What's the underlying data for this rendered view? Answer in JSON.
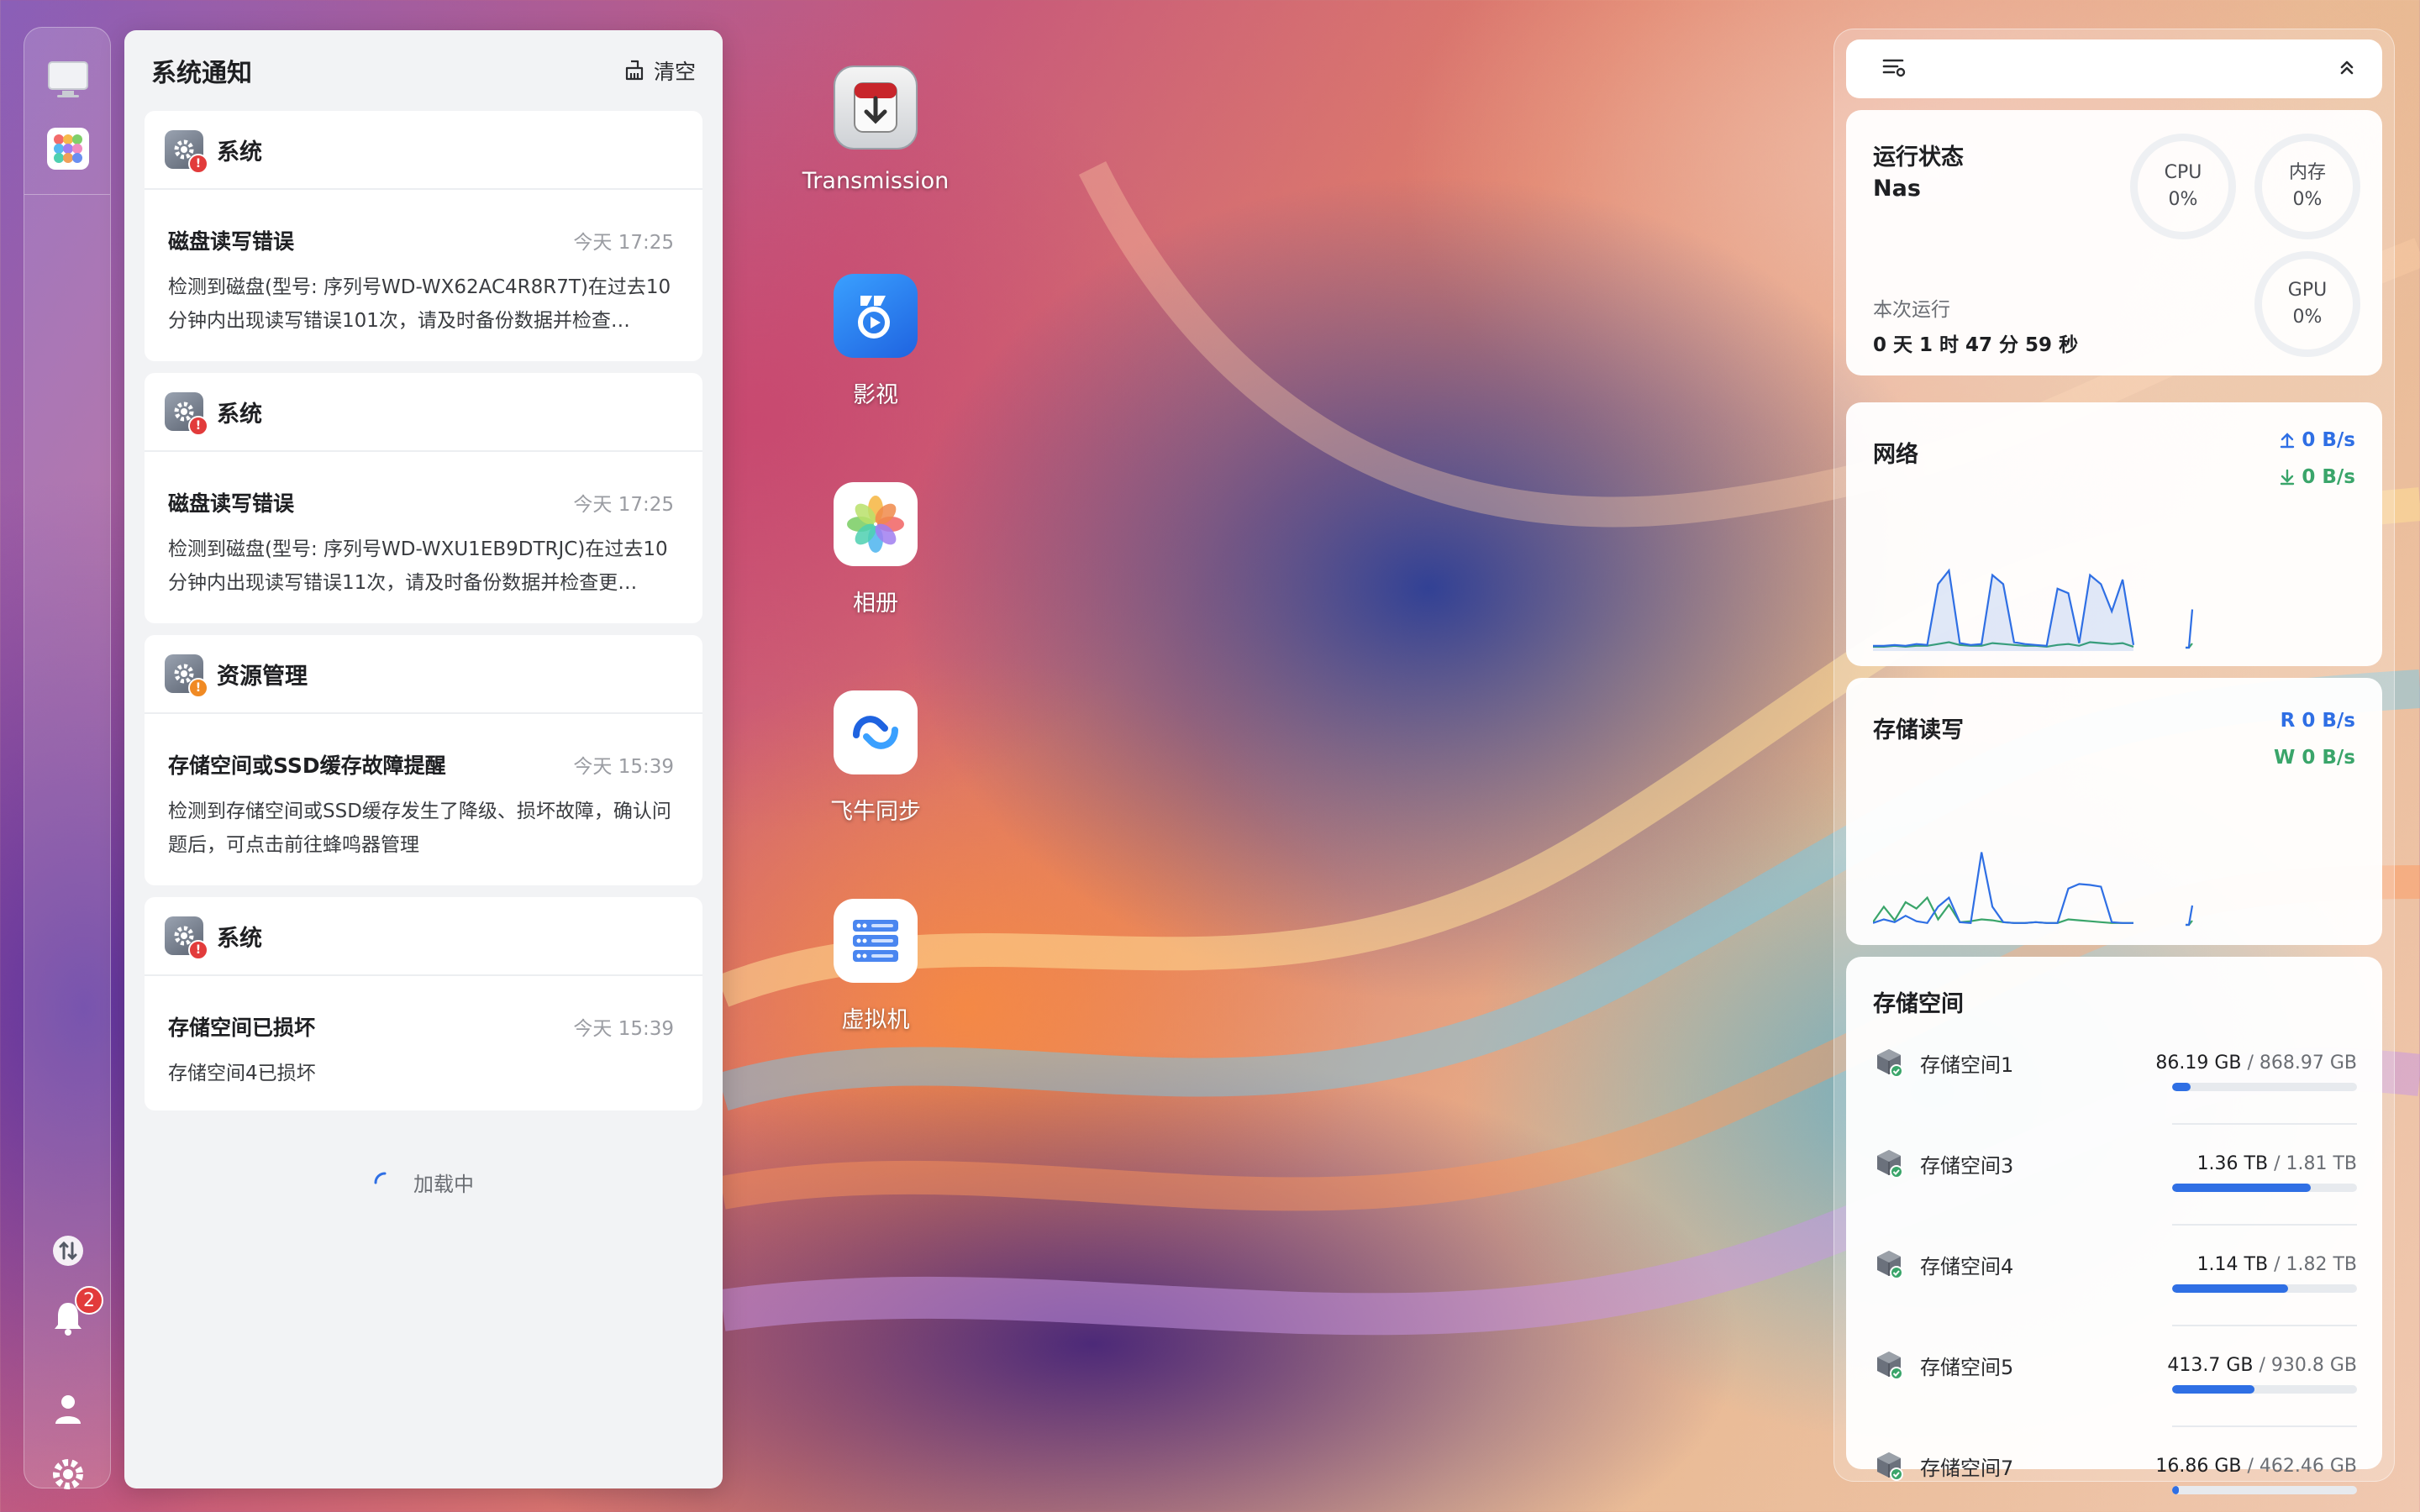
{
  "notifications": {
    "title": "系统通知",
    "clear_label": "清空",
    "loading_label": "加载中",
    "cards": [
      {
        "app": "系统",
        "badge": "red",
        "title": "磁盘读写错误",
        "time": "今天 17:25",
        "text": "检测到磁盘(型号: 序列号WD-WX62AC4R8R7T)在过去10分钟内出现读写错误101次，请及时备份数据并检查…"
      },
      {
        "app": "系统",
        "badge": "red",
        "title": "磁盘读写错误",
        "time": "今天 17:25",
        "text": "检测到磁盘(型号: 序列号WD-WXU1EB9DTRJC)在过去10分钟内出现读写错误11次，请及时备份数据并检查更…"
      },
      {
        "app": "资源管理",
        "badge": "orange",
        "title": "存储空间或SSD缓存故障提醒",
        "time": "今天 15:39",
        "text": "检测到存储空间或SSD缓存发生了降级、损坏故障，确认问题后，可点击前往蜂鸣器管理"
      },
      {
        "app": "系统",
        "badge": "red",
        "title": "存储空间已损坏",
        "time": "今天 15:39",
        "text": "存储空间4已损坏"
      }
    ]
  },
  "dock": {
    "bell_badge": "2",
    "icons": [
      "desktop-icon",
      "app-grid-icon",
      "transfer-icon",
      "bell-icon",
      "user-icon",
      "settings-icon"
    ]
  },
  "desktop_icons": [
    {
      "name": "transmission",
      "label": "Transmission",
      "icon": "download-box-icon"
    },
    {
      "name": "video",
      "label": "影视",
      "icon": "play-icon"
    },
    {
      "name": "photos",
      "label": "相册",
      "icon": "flower-icon"
    },
    {
      "name": "sync",
      "label": "飞牛同步",
      "icon": "sync-icon"
    },
    {
      "name": "vm",
      "label": "虚拟机",
      "icon": "server-icon"
    }
  ],
  "status": {
    "title": "运行状态",
    "host": "Nas",
    "cpu_label": "CPU",
    "cpu_value": "0%",
    "mem_label": "内存",
    "mem_value": "0%",
    "gpu_label": "GPU",
    "gpu_value": "0%",
    "uptime_label": "本次运行",
    "uptime": "0 天 1 时 47 分 59 秒"
  },
  "network": {
    "title": "网络",
    "up": "0 B/s",
    "down": "0 B/s",
    "up_series": [
      2,
      2,
      3,
      2,
      4,
      3,
      70,
      85,
      5,
      3,
      4,
      80,
      70,
      6,
      4,
      3,
      2,
      65,
      60,
      5,
      80,
      70,
      40,
      75,
      3
    ],
    "down_series": [
      1,
      1,
      2,
      1,
      2,
      2,
      4,
      6,
      3,
      2,
      2,
      5,
      4,
      3,
      2,
      2,
      1,
      3,
      4,
      2,
      6,
      5,
      4,
      5,
      1
    ]
  },
  "storage_io": {
    "title": "存储读写",
    "read_label": "R",
    "read": "0 B/s",
    "write_label": "W",
    "write": "0 B/s",
    "read_series": [
      2,
      6,
      3,
      10,
      4,
      2,
      20,
      30,
      3,
      2,
      80,
      20,
      3,
      2,
      2,
      3,
      2,
      2,
      40,
      45,
      44,
      42,
      3,
      2,
      2
    ],
    "write_series": [
      3,
      20,
      5,
      25,
      18,
      30,
      6,
      22,
      3,
      4,
      6,
      5,
      3,
      2,
      2,
      3,
      2,
      2,
      6,
      5,
      4,
      3,
      2,
      2,
      2
    ]
  },
  "storage": {
    "title": "存储空间",
    "volumes": [
      {
        "name": "存储空间1",
        "used": "86.19 GB",
        "total": "868.97 GB",
        "ratio": 0.099
      },
      {
        "name": "存储空间3",
        "used": "1.36 TB",
        "total": "1.81 TB",
        "ratio": 0.751
      },
      {
        "name": "存储空间4",
        "used": "1.14 TB",
        "total": "1.82 TB",
        "ratio": 0.626
      },
      {
        "name": "存储空间5",
        "used": "413.7 GB",
        "total": "930.8 GB",
        "ratio": 0.444
      },
      {
        "name": "存储空间7",
        "used": "16.86 GB",
        "total": "462.46 GB",
        "ratio": 0.036
      }
    ]
  }
}
